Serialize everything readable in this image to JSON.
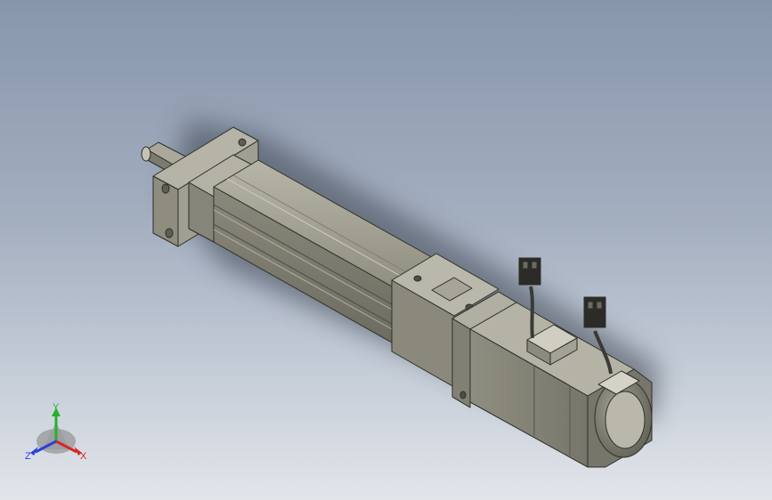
{
  "viewport": {
    "background_top": "#8896ab",
    "background_bottom": "#e2e5ea",
    "model_color": "#8d8c7e"
  },
  "triad": {
    "x_label": "X",
    "y_label": "Y",
    "z_label": "Z",
    "x_color": "#d8262a",
    "y_color": "#27b02b",
    "z_color": "#2c3fd6"
  }
}
